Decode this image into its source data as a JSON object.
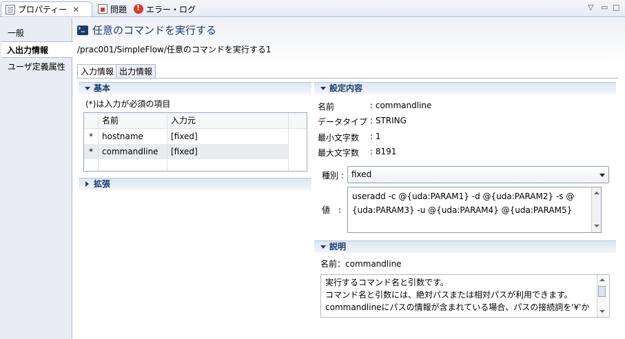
{
  "view_tabs": {
    "properties": "プロパティー",
    "problems": "問題",
    "error_log": "エラー・ログ"
  },
  "left_tabs": [
    "一般",
    "入出力情報",
    "ユーザ定義属性"
  ],
  "header": {
    "title": "任意のコマンドを実行する",
    "path": "/prac001/SimpleFlow/任意のコマンドを実行する1"
  },
  "inner_tabs": [
    "入力情報",
    "出力情報"
  ],
  "basic": {
    "section": "基本",
    "required_note": "(*)は入力が必須の項目",
    "columns": [
      "名前",
      "入力元"
    ],
    "rows": [
      {
        "mark": "*",
        "name": "hostname",
        "source": "[fixed]"
      },
      {
        "mark": "*",
        "name": "commandline",
        "source": "[fixed]"
      }
    ]
  },
  "extension": {
    "section": "拡張"
  },
  "settings": {
    "section": "設定内容",
    "fields": [
      {
        "label": "名前",
        "value": ": commandline"
      },
      {
        "label": "データタイプ",
        "value": ": STRING"
      },
      {
        "label": "最小文字数",
        "value": ": 1"
      },
      {
        "label": "最大文字数",
        "value": ": 8191"
      }
    ],
    "kind_label": "種別 :",
    "kind_value": "fixed",
    "value_label": "値　:",
    "value_lines": [
      "useradd -c @{uda:PARAM1} -d @{uda:PARAM2} -s @",
      "{uda:PARAM3} -u @{uda:PARAM4} @{uda:PARAM5}"
    ]
  },
  "description": {
    "section": "説明",
    "name_line": "名前：commandline",
    "lines": [
      "実行するコマンド名と引数です。",
      "コマンド名と引数には、絶対パスまたは相対パスが利用できます。",
      "commandlineにパスの情報が含まれている場合、パスの接続詞を'¥'か"
    ]
  }
}
